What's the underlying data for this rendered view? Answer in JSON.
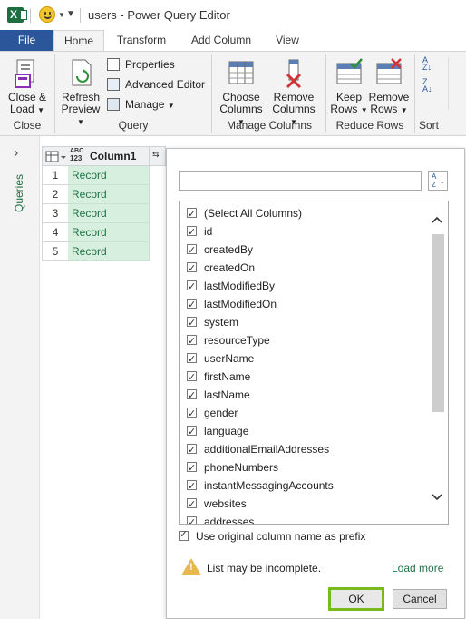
{
  "window": {
    "title": "users - Power Query Editor"
  },
  "ribbon": {
    "tabs": [
      "File",
      "Home",
      "Transform",
      "Add Column",
      "View"
    ],
    "groups": {
      "close": {
        "label": "Close",
        "close_load": "Close &",
        "close_load2": "Load"
      },
      "query": {
        "label": "Query",
        "refresh": "Refresh",
        "refresh2": "Preview",
        "properties": "Properties",
        "advanced_editor": "Advanced Editor",
        "manage": "Manage"
      },
      "manage_columns": {
        "label": "Manage Columns",
        "choose": "Choose",
        "choose2": "Columns",
        "remove": "Remove",
        "remove2": "Columns"
      },
      "reduce_rows": {
        "label": "Reduce Rows",
        "keep": "Keep",
        "keep2": "Rows",
        "remove": "Remove",
        "remove2": "Rows"
      },
      "sort": {
        "label": "Sort"
      }
    }
  },
  "sidebar": {
    "label": "Queries"
  },
  "grid": {
    "type_badge_top": "ABC",
    "type_badge_bottom": "123",
    "column_header": "Column1",
    "rows": [
      {
        "index": "1",
        "value": "Record"
      },
      {
        "index": "2",
        "value": "Record"
      },
      {
        "index": "3",
        "value": "Record"
      },
      {
        "index": "4",
        "value": "Record"
      },
      {
        "index": "5",
        "value": "Record"
      }
    ]
  },
  "popup": {
    "search": {
      "value": "",
      "placeholder": ""
    },
    "columns": [
      "(Select All Columns)",
      "id",
      "createdBy",
      "createdOn",
      "lastModifiedBy",
      "lastModifiedOn",
      "system",
      "resourceType",
      "userName",
      "firstName",
      "lastName",
      "gender",
      "language",
      "additionalEmailAddresses",
      "phoneNumbers",
      "instantMessagingAccounts",
      "websites",
      "addresses"
    ],
    "prefix_label": "Use original column name as prefix",
    "warning": "List may be incomplete.",
    "load_more": "Load more",
    "ok": "OK",
    "cancel": "Cancel"
  },
  "colors": {
    "accent_green": "#217346",
    "file_tab": "#2b579a",
    "ok_highlight": "#78b91c"
  }
}
